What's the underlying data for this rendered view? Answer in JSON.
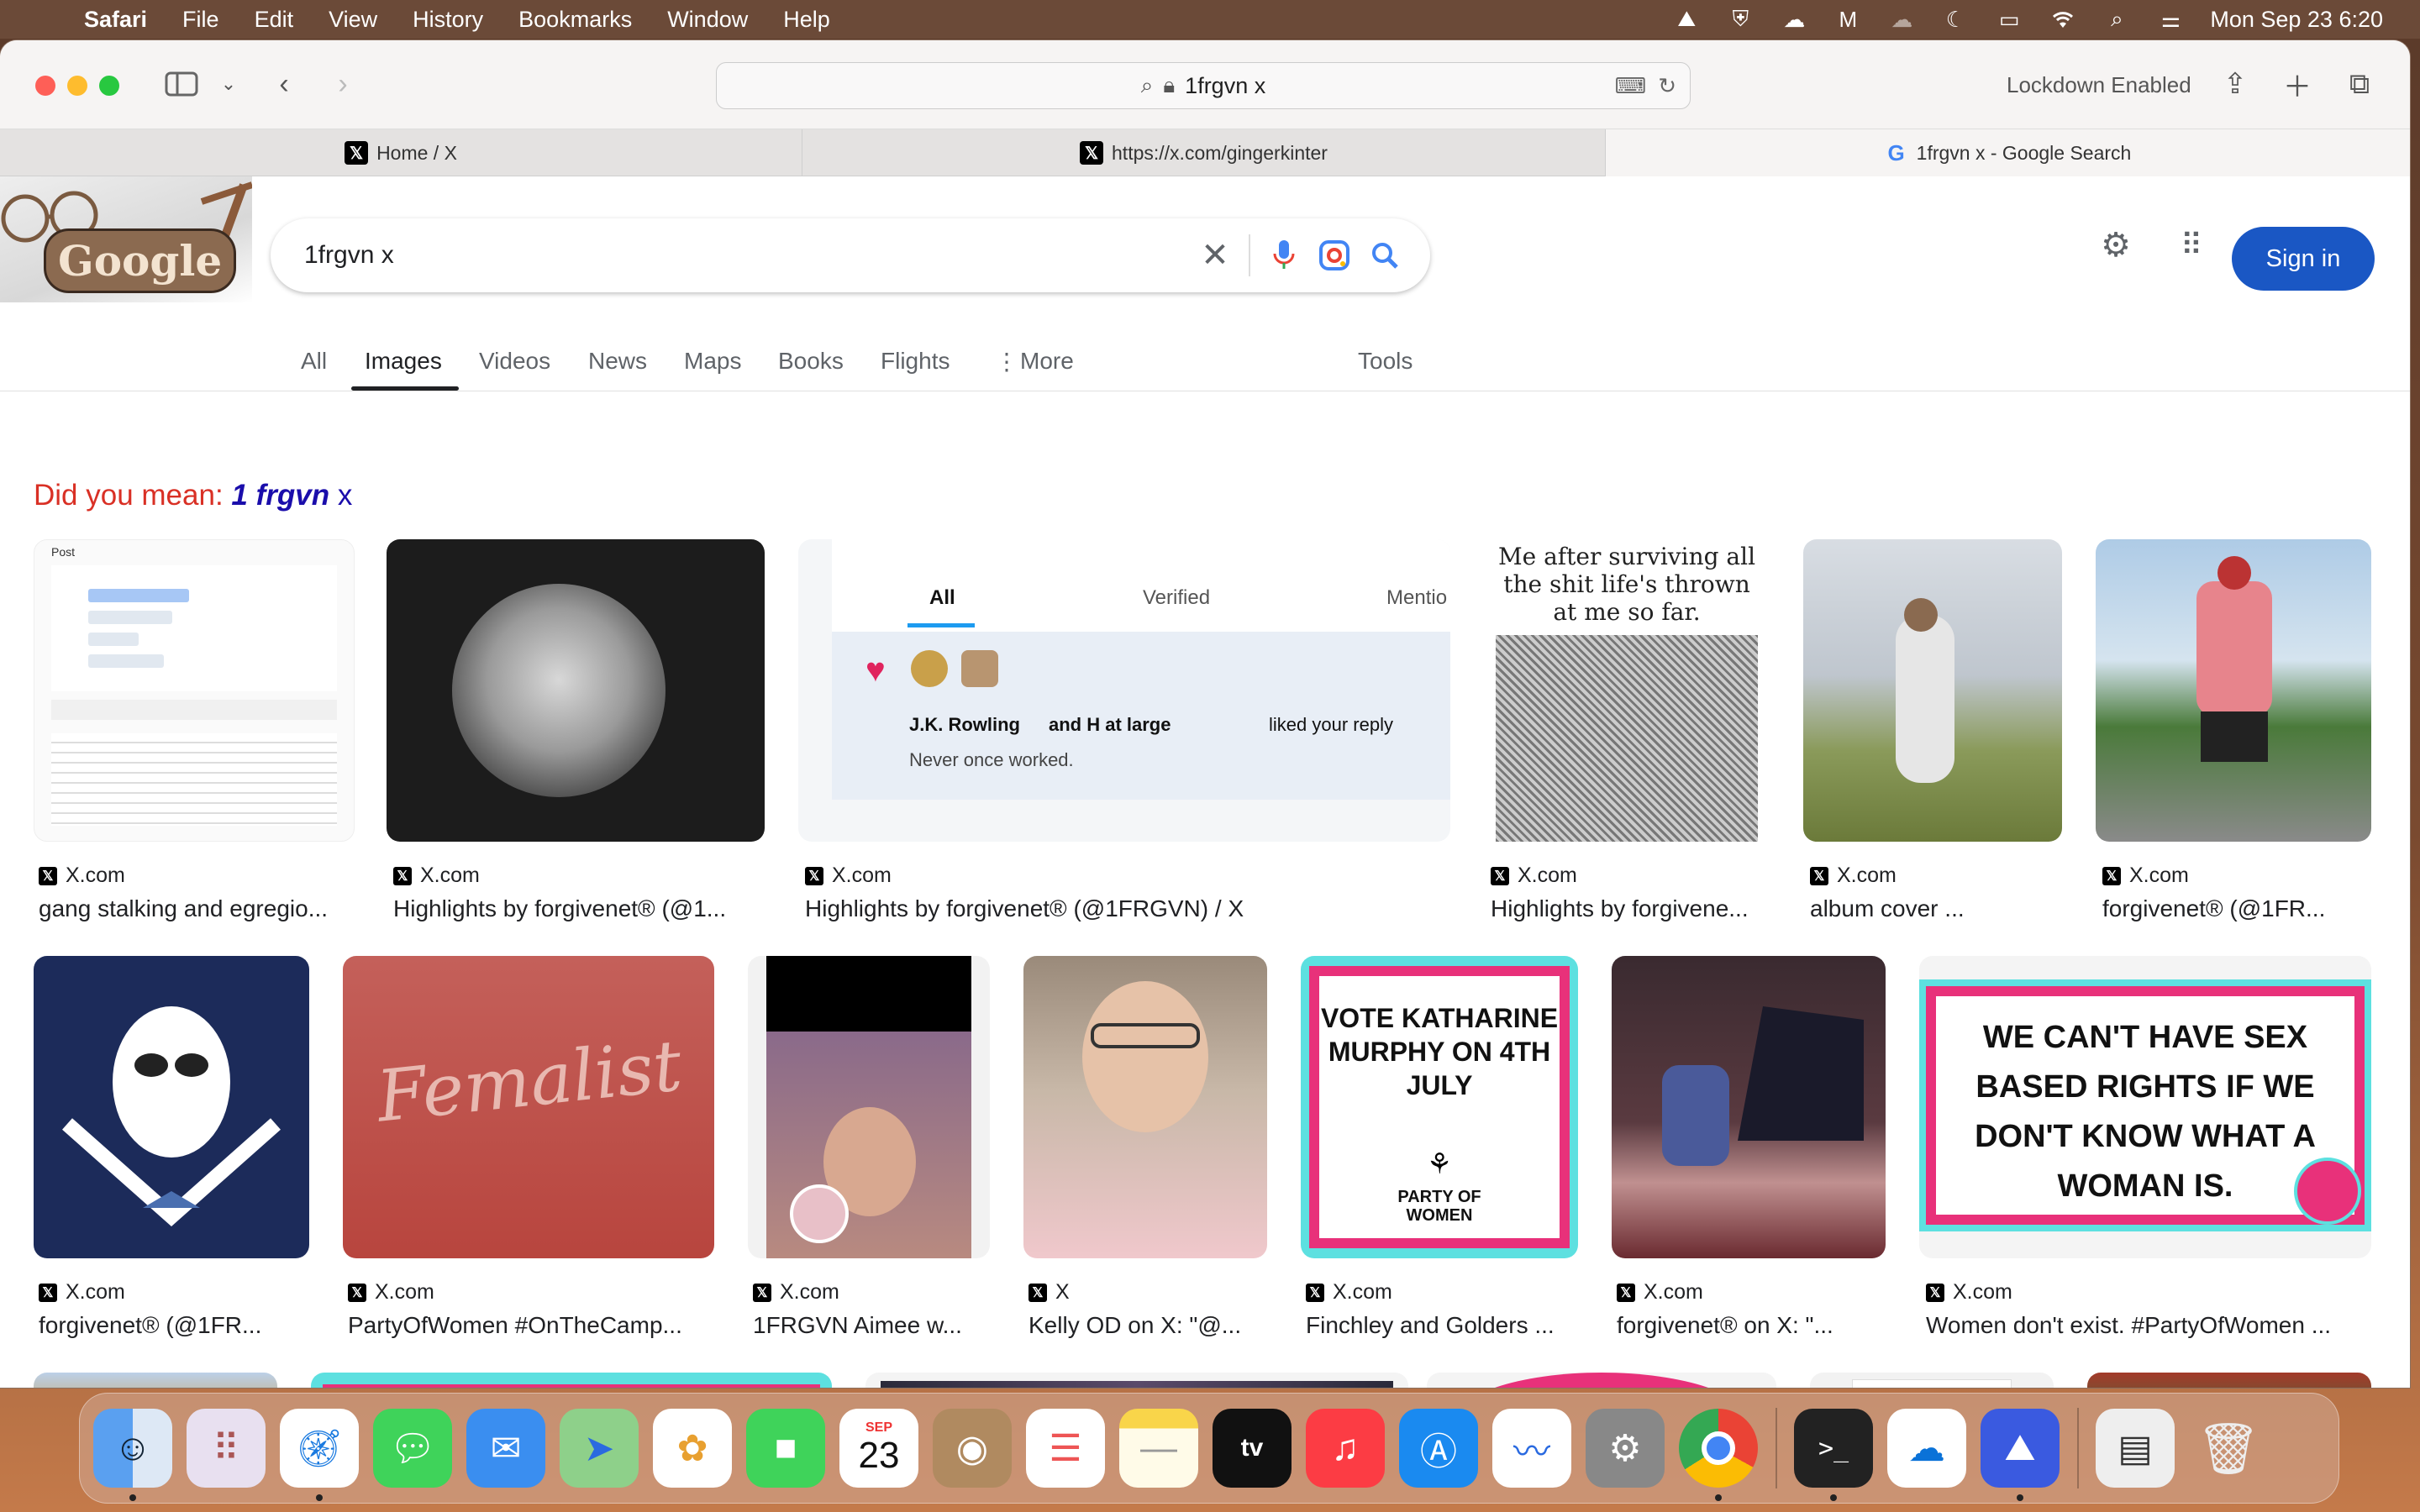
{
  "menubar": {
    "app": "Safari",
    "items": [
      "File",
      "Edit",
      "View",
      "History",
      "Bookmarks",
      "Window",
      "Help"
    ],
    "clock": "Mon Sep 23  6:20"
  },
  "toolbar": {
    "url": "1frgvn x",
    "lockdown": "Lockdown Enabled"
  },
  "tabs": [
    {
      "label": "Home / X",
      "icon": "x-icon"
    },
    {
      "label": "https://x.com/gingerkinter",
      "icon": "x-icon"
    },
    {
      "label": "1frgvn x - Google Search",
      "icon": "google-icon"
    }
  ],
  "google": {
    "logo": "Google",
    "query": "1frgvn x",
    "signin": "Sign in",
    "nav": [
      "All",
      "Images",
      "Videos",
      "News",
      "Maps",
      "Books",
      "Flights",
      "More"
    ],
    "tools": "Tools",
    "did_you_mean_label": "Did you mean:",
    "did_you_mean_strong": "1 frgvn",
    "did_you_mean_rest": "x"
  },
  "row1": [
    {
      "source": "X.com",
      "title": "gang stalking and egregio..."
    },
    {
      "source": "X.com",
      "title": "Highlights by forgivenet® (@1..."
    },
    {
      "source": "X.com",
      "title": "Highlights by forgivenet® (@1FRGVN) / X"
    },
    {
      "source": "X.com",
      "title": "Highlights by forgivene..."
    },
    {
      "source": "X.com",
      "title": "album cover ..."
    },
    {
      "source": "X.com",
      "title": "forgivenet® (@1FR..."
    }
  ],
  "row2": [
    {
      "source": "X.com",
      "title": "forgivenet® (@1FR..."
    },
    {
      "source": "X.com",
      "title": "PartyOfWomen #OnTheCamp..."
    },
    {
      "source": "X.com",
      "title": "1FRGVN Aimee w..."
    },
    {
      "source": "X",
      "title": "Kelly OD on X: \"@..."
    },
    {
      "source": "X.com",
      "title": "Finchley and Golders ..."
    },
    {
      "source": "X.com",
      "title": "forgivenet® on X: \"..."
    },
    {
      "source": "X.com",
      "title": "Women don't exist. #PartyOfWomen ..."
    }
  ],
  "thumb_text": {
    "poll_header": "Post",
    "tweet_all": "All",
    "tweet_verified": "Verified",
    "tweet_mentions": "Mentio",
    "tweet_liked_name": "J.K. Rowling",
    "tweet_liked_rest": "and H at large",
    "tweet_liked_tail": "liked your reply",
    "tweet_reply": "Never once worked.",
    "meme_caption": "Me after surviving all the shit life's thrown at me so far.",
    "shirt": "Femalist",
    "vote": "VOTE KATHARINE MURPHY ON 4TH JULY",
    "party": "PARTY OF WOMEN",
    "sexbased": "WE CAN'T HAVE SEX BASED RIGHTS IF WE DON'T KNOW WHAT A WOMAN IS.",
    "dock_date_month": "SEP",
    "dock_date_day": "23",
    "dock_tv": "tv"
  }
}
